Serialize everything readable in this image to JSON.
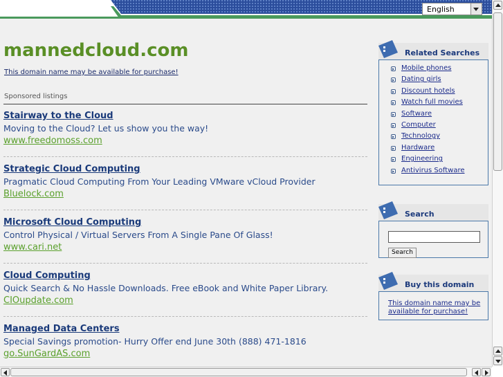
{
  "header": {
    "language": "English",
    "colors": {
      "band": "#4a9a5c",
      "pattern": "#2b4d9c"
    }
  },
  "main": {
    "domain_title": "mannedcloud.com",
    "availability_link": "This domain name may be available for purchase!",
    "sponsored_label": "Sponsored listings",
    "listings": [
      {
        "title": "Stairway to the Cloud",
        "description": "Moving to the Cloud? Let us show you the way!",
        "url": "www.freedomoss.com"
      },
      {
        "title": "Strategic Cloud Computing",
        "description": "Pragmatic Cloud Computing From Your Leading VMware vCloud Provider",
        "url": "Bluelock.com"
      },
      {
        "title": "Microsoft Cloud Computing",
        "description": "Control Physical / Virtual Servers From A Single Pane Of Glass!",
        "url": "www.cari.net"
      },
      {
        "title": "Cloud Computing",
        "description": "Quick Search & No Hassle Downloads. Free eBook and White Paper Library.",
        "url": "CIOupdate.com"
      },
      {
        "title": "Managed Data Centers",
        "description": "Special Savings promotion- Hurry Offer end June 30th (888) 471-1816",
        "url": "go.SunGardAS.com"
      }
    ],
    "colors": {
      "title_green": "#5a8f26",
      "link_blue": "#1a3a7a",
      "url_green": "#5aa02c"
    }
  },
  "sidebar": {
    "related": {
      "title": "Related Searches",
      "items": [
        "Mobile phones",
        "Dating girls",
        "Discount hotels",
        "Watch full movies",
        "Software",
        "Computer",
        "Technology",
        "Hardware",
        "Engineering",
        "Antivirus Software"
      ]
    },
    "search": {
      "title": "Search",
      "button_label": "Search",
      "input_value": ""
    },
    "buy": {
      "title": "Buy this domain",
      "link": "This domain name may be available for purchase!"
    }
  }
}
